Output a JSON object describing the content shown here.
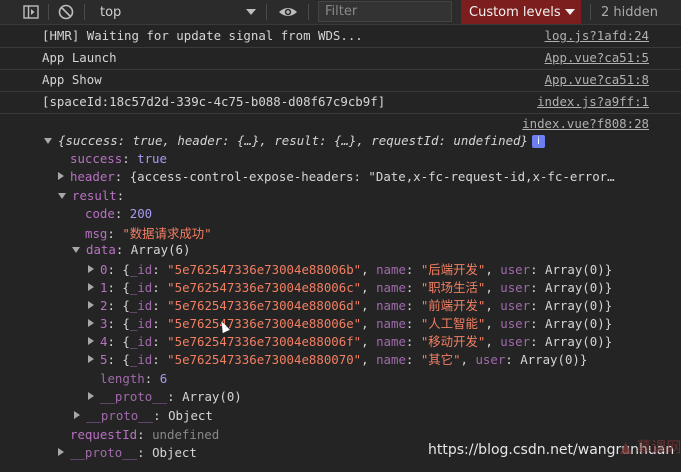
{
  "toolbar": {
    "context": "top",
    "filter_placeholder": "Filter",
    "levels_label": "Custom levels",
    "hidden_count": "2 hidden"
  },
  "logs": [
    {
      "message": "[HMR] Waiting for update signal from WDS...",
      "source": "log.js?1afd:24"
    },
    {
      "message": "App Launch",
      "source": "App.vue?ca51:5"
    },
    {
      "message": "App Show",
      "source": "App.vue?ca51:8"
    },
    {
      "message": "[spaceId:18c57d2d-339c-4c75-b088-d08f67c9cb9f]",
      "source": "index.js?a9ff:1"
    }
  ],
  "object_log": {
    "source": "index.vue?f808:28",
    "summary": "{success: true, header: {…}, result: {…}, requestId: undefined}",
    "success": "true",
    "header_preview": "{access-control-expose-headers: \"Date,x-fc-request-id,x-fc-error…",
    "code": "200",
    "msg": "\"数据请求成功\"",
    "data_label": "Array(6)",
    "items": [
      {
        "index": "0",
        "id": "\"5e762547336e73004e88006b\"",
        "name": "\"后端开发\"",
        "user": "Array(0)"
      },
      {
        "index": "1",
        "id": "\"5e762547336e73004e88006c\"",
        "name": "\"职场生活\"",
        "user": "Array(0)"
      },
      {
        "index": "2",
        "id": "\"5e762547336e73004e88006d\"",
        "name": "\"前端开发\"",
        "user": "Array(0)"
      },
      {
        "index": "3",
        "id": "\"5e762547336e73004e88006e\"",
        "name": "\"人工智能\"",
        "user": "Array(0)"
      },
      {
        "index": "4",
        "id": "\"5e762547336e73004e88006f\"",
        "name": "\"移动开发\"",
        "user": "Array(0)"
      },
      {
        "index": "5",
        "id": "\"5e762547336e73004e880070\"",
        "name": "\"其它\"",
        "user": "Array(0)"
      }
    ],
    "length": "6",
    "proto_array": "Array(0)",
    "proto_object": "Object",
    "requestId": "undefined"
  },
  "watermark": "https://blog.csdn.net/wangrunhuan",
  "watermark_logo": "慕课网",
  "colors": {
    "background": "#242424",
    "levels_bg": "#7d1e1e",
    "string": "#f27f63",
    "key": "#b871c2",
    "number": "#a999f0"
  }
}
